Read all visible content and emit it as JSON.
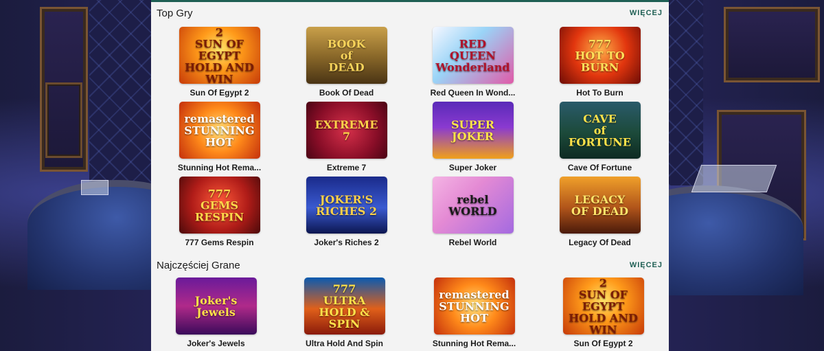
{
  "sections": [
    {
      "title": "Top Gry",
      "more_label": "WIĘCEJ",
      "games": [
        {
          "name": "Sun Of Egypt 2",
          "art": "2\nSUN OF EGYPT\nHOLD AND WIN",
          "bg": "radial-gradient(circle at 50% 40%, #ffe46a 0%, #ff9a1a 40%, #c63a08 100%)",
          "fg": "#7a1c05"
        },
        {
          "name": "Book Of Dead",
          "art": "BOOK\nof\nDEAD",
          "bg": "linear-gradient(180deg, #c9a04a 0%, #8c6a2a 50%, #4a3414 100%)",
          "fg": "#f7d35a"
        },
        {
          "name": "Red Queen In Wond...",
          "art": "RED QUEEN\nWonderland",
          "bg": "linear-gradient(135deg, #f5f7ff 0%, #9ad4f7 40%, #e05aa8 100%)",
          "fg": "#b0122a"
        },
        {
          "name": "Hot To Burn",
          "art": "777\nHOT TO BURN",
          "bg": "radial-gradient(circle at 50% 40%, #ffb14a 0%, #e2360e 50%, #6d0c05 100%)",
          "fg": "#ffe05a"
        },
        {
          "name": "Stunning Hot Rema...",
          "art": "remastered\nSTUNNING\nHOT",
          "bg": "radial-gradient(circle at 50% 50%, #ffe07a 0%, #ff8a1a 45%, #c4300c 100%)",
          "fg": "#ffffff"
        },
        {
          "name": "Extreme 7",
          "art": "EXTREME\n7",
          "bg": "radial-gradient(circle at 50% 50%, #d6304a 0%, #8a0e28 60%, #4a0414 100%)",
          "fg": "#ffd24a"
        },
        {
          "name": "Super Joker",
          "art": "SUPER\nJOKER",
          "bg": "linear-gradient(180deg, #5a2ab8 0%, #8a3ad0 45%, #f0a01a 100%)",
          "fg": "#ffe44a"
        },
        {
          "name": "Cave Of Fortune",
          "art": "CAVE\nof\nFORTUNE",
          "bg": "linear-gradient(180deg, #2a5a6a 0%, #1c4a3a 55%, #0e2a22 100%)",
          "fg": "#ffe24a"
        },
        {
          "name": "777 Gems Respin",
          "art": "777\nGEMS\nRESPIN",
          "bg": "radial-gradient(circle at 50% 45%, #ff5a3a 0%, #b01c18 55%, #4a0a0a 100%)",
          "fg": "#ffd84a"
        },
        {
          "name": "Joker's Riches 2",
          "art": "JOKER'S\nRICHES 2",
          "bg": "linear-gradient(180deg, #1a2a8a 0%, #3a5ad0 55%, #0c1650 100%)",
          "fg": "#ffd24a"
        },
        {
          "name": "Rebel World",
          "art": "rebel\nWORLD",
          "bg": "linear-gradient(135deg, #f4b4e4 0%, #e48ad4 40%, #a46ae0 100%)",
          "fg": "#1a1a1a"
        },
        {
          "name": "Legacy Of Dead",
          "art": "LEGACY\nOF DEAD",
          "bg": "linear-gradient(180deg, #f0a02a 0%, #b0541a 55%, #4a1a0a 100%)",
          "fg": "#ffe46a"
        }
      ]
    },
    {
      "title": "Najczęściej Grane",
      "more_label": "WIĘCEJ",
      "games": [
        {
          "name": "Joker's Jewels",
          "art": "Joker's\nJewels",
          "bg": "linear-gradient(180deg, #6a1a9a 0%, #b02a8a 50%, #3a0a5a 100%)",
          "fg": "#ffe04a"
        },
        {
          "name": "Ultra Hold And Spin",
          "art": "777\nULTRA\nHOLD & SPIN",
          "bg": "linear-gradient(180deg, #0a5ab0 0%, #e0601a 55%, #8a1a0a 100%)",
          "fg": "#ffe04a"
        },
        {
          "name": "Stunning Hot Rema...",
          "art": "remastered\nSTUNNING\nHOT",
          "bg": "radial-gradient(circle at 50% 50%, #ffe07a 0%, #ff8a1a 45%, #c4300c 100%)",
          "fg": "#ffffff"
        },
        {
          "name": "Sun Of Egypt 2",
          "art": "2\nSUN OF EGYPT\nHOLD AND WIN",
          "bg": "radial-gradient(circle at 50% 40%, #ffe46a 0%, #ff9a1a 40%, #c63a08 100%)",
          "fg": "#7a1c05"
        }
      ]
    }
  ],
  "colors": {
    "accent": "#1f5f54",
    "panel_bg": "#f3f3f3",
    "text": "#1b1b1b"
  }
}
